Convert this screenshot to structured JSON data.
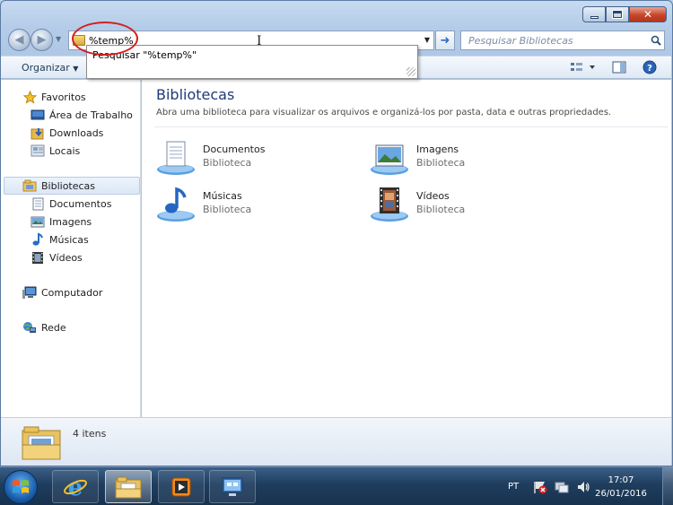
{
  "window": {
    "close_glyph": "✕"
  },
  "nav": {
    "address_value": "%temp%",
    "search_placeholder": "Pesquisar Bibliotecas",
    "suggestion": "Pesquisar \"%temp%\""
  },
  "toolbar": {
    "organize_label": "Organizar"
  },
  "sidebar": {
    "favorites": "Favoritos",
    "desktop": "Área de Trabalho",
    "downloads": "Downloads",
    "locals": "Locais",
    "libraries": "Bibliotecas",
    "lib_docs": "Documentos",
    "lib_images": "Imagens",
    "lib_music": "Músicas",
    "lib_videos": "Vídeos",
    "computer": "Computador",
    "network": "Rede"
  },
  "main": {
    "title": "Bibliotecas",
    "subtitle": "Abra uma biblioteca para visualizar os arquivos e organizá-los por pasta, data e outras propriedades.",
    "tiles": [
      {
        "name": "Documentos",
        "kind": "Biblioteca",
        "icon": "documents-library-icon"
      },
      {
        "name": "Imagens",
        "kind": "Biblioteca",
        "icon": "pictures-library-icon"
      },
      {
        "name": "Músicas",
        "kind": "Biblioteca",
        "icon": "music-library-icon"
      },
      {
        "name": "Vídeos",
        "kind": "Biblioteca",
        "icon": "videos-library-icon"
      }
    ]
  },
  "details": {
    "count": "4 itens"
  },
  "taskbar": {
    "lang": "PT",
    "time": "17:07",
    "date": "26/01/2016"
  },
  "colors": {
    "accent_blue": "#1e3a78",
    "oval_red": "#d31f1f",
    "taskbar": "#1f3d5e"
  }
}
